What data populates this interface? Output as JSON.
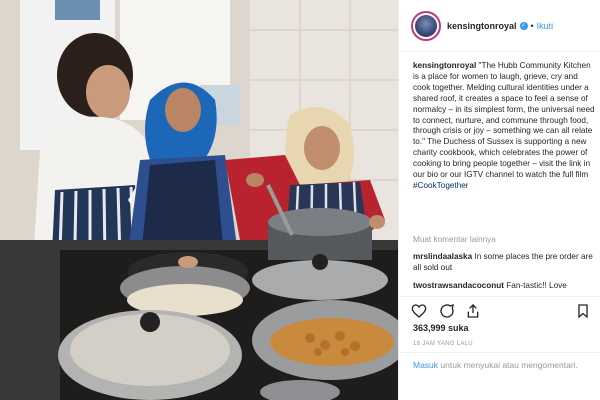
{
  "post": {
    "username": "kensingtonroyal",
    "follow_label": "Ikuti",
    "caption_user": "kensingtonroyal",
    "caption_text": "\"The Hubb Community Kitchen is a place for women to laugh, grieve, cry and cook together. Melding cultural identities under a shared roof, it creates a space to feel a sense of normalcy – in its simplest form, the universal need to connect, nurture, and commune through food, through crisis or joy – something we can all relate to.\" The Duchess of Sussex is supporting a new charity cookbook, which celebrates the power of cooking to bring people together – visit the link in our bio or our IGTV channel to watch the full film",
    "hashtag": "#CookTogether",
    "more_comments": "Muat komentar lainnya",
    "comments": [
      {
        "user": "mrslindaalaska",
        "text": "In some places the pre order are all sold out"
      },
      {
        "user": "twostrawsandacoconut",
        "text": "Fan-tastic!! Love"
      }
    ],
    "likes": "363,999 suka",
    "time_ago": "18 JAM YANG LALU",
    "login_link": "Masuk",
    "login_text": "untuk menyukai atau mengomentari."
  },
  "colors": {
    "accent_blue": "#3897f0",
    "hashtag": "#003569",
    "muted": "#999999"
  },
  "icons": [
    "verified-badge-icon",
    "heart-icon",
    "comment-icon",
    "share-icon",
    "bookmark-icon"
  ]
}
